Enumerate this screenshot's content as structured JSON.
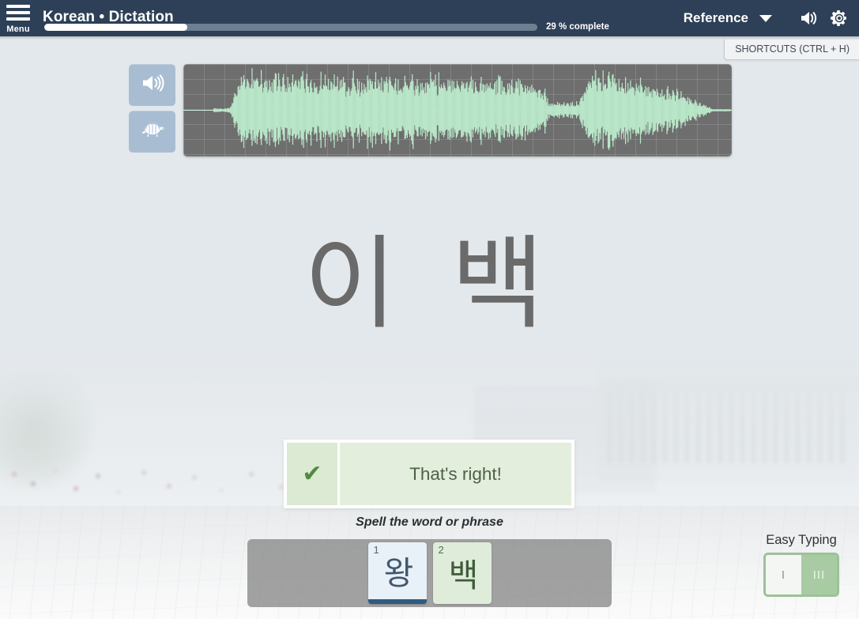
{
  "header": {
    "menu_label": "Menu",
    "title": "Korean • Dictation",
    "progress_percent": 29,
    "progress_text": "29 % complete",
    "reference_label": "Reference",
    "dropdown_icon": "chevron-down-icon",
    "volume_icon": "volume-icon",
    "settings_icon": "gear-icon"
  },
  "shortcuts": {
    "label": "SHORTCUTS (CTRL + H)"
  },
  "audio": {
    "play_icon": "speaker-icon",
    "slow_icon": "turtle-icon",
    "waveform_label": "audio-waveform"
  },
  "prompt": {
    "word": "이 백"
  },
  "feedback": {
    "check_icon": "✔",
    "message": "That's right!",
    "hint": "Spell the word or phrase"
  },
  "tiles": [
    {
      "number": "1",
      "char": "왕",
      "state": "selected"
    },
    {
      "number": "2",
      "char": "백",
      "state": "correct"
    }
  ],
  "easy_typing": {
    "label": "Easy Typing",
    "option_off": "I",
    "option_on": "III",
    "active": "on"
  },
  "colors": {
    "header_bg": "#2e4057",
    "accent_blue": "#a8bdd2",
    "wave_green": "#b9e6c8",
    "wave_bg": "#6e6e6e",
    "correct_green": "#dce9d3",
    "tile_blue": "#e9f1f8",
    "tile_green": "#dfecd9",
    "toggle_green": "#a9cba4"
  }
}
